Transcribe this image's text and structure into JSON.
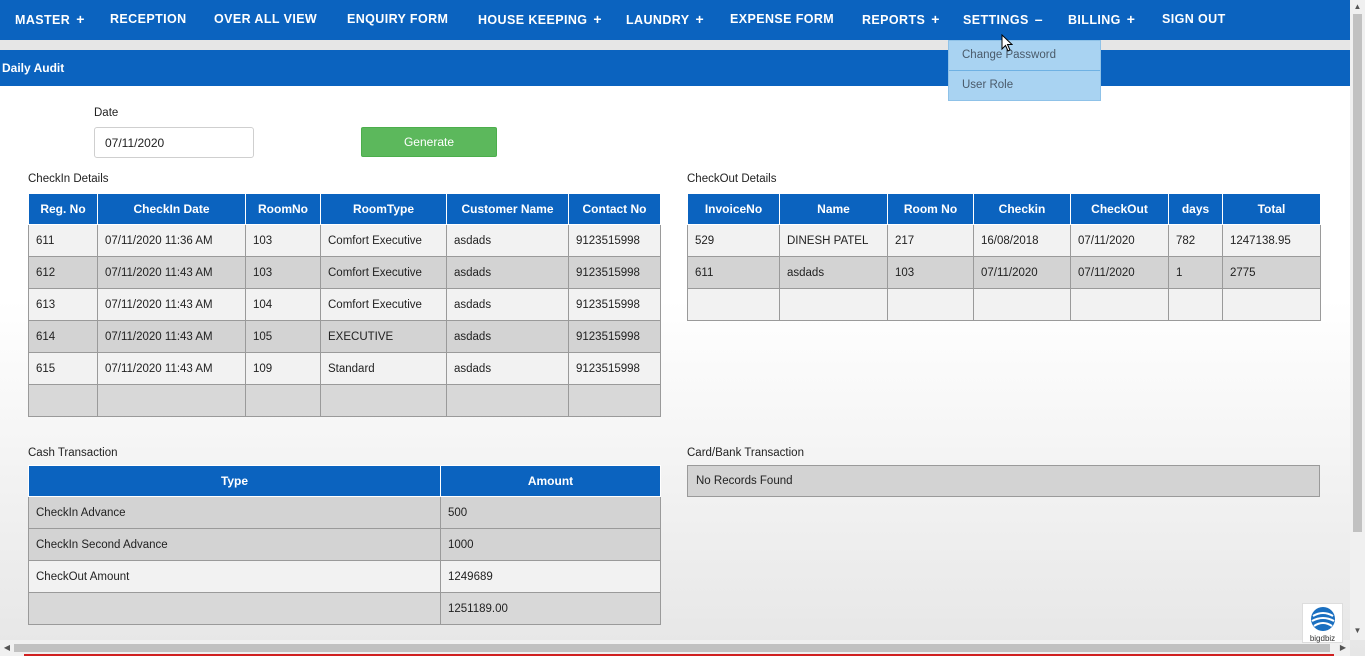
{
  "nav": {
    "items": [
      {
        "label": "MASTER",
        "sign": "+"
      },
      {
        "label": "RECEPTION",
        "sign": ""
      },
      {
        "label": "OVER ALL VIEW",
        "sign": ""
      },
      {
        "label": "ENQUIRY FORM",
        "sign": ""
      },
      {
        "label": "HOUSE KEEPING",
        "sign": "+"
      },
      {
        "label": "LAUNDRY",
        "sign": "+"
      },
      {
        "label": "EXPENSE FORM",
        "sign": ""
      },
      {
        "label": "REPORTS",
        "sign": "+"
      },
      {
        "label": "SETTINGS",
        "sign": "–"
      },
      {
        "label": "BILLING",
        "sign": "+"
      },
      {
        "label": "SIGN OUT",
        "sign": ""
      }
    ],
    "settings_menu": [
      "Change Password",
      "User Role"
    ]
  },
  "page_title": "Daily Audit",
  "form": {
    "date_label": "Date",
    "date_value": "07/11/2020",
    "generate_label": "Generate"
  },
  "checkin": {
    "title": "CheckIn Details",
    "headers": [
      "Reg. No",
      "CheckIn Date",
      "RoomNo",
      "RoomType",
      "Customer Name",
      "Contact No"
    ],
    "rows": [
      [
        "611",
        "07/11/2020 11:36 AM",
        "103",
        "Comfort Executive",
        "asdads",
        "9123515998"
      ],
      [
        "612",
        "07/11/2020 11:43 AM",
        "103",
        "Comfort Executive",
        "asdads",
        "9123515998"
      ],
      [
        "613",
        "07/11/2020 11:43 AM",
        "104",
        "Comfort Executive",
        "asdads",
        "9123515998"
      ],
      [
        "614",
        "07/11/2020 11:43 AM",
        "105",
        "EXECUTIVE",
        "asdads",
        "9123515998"
      ],
      [
        "615",
        "07/11/2020 11:43 AM",
        "109",
        "Standard",
        "asdads",
        "9123515998"
      ]
    ]
  },
  "checkout": {
    "title": "CheckOut Details",
    "headers": [
      "InvoiceNo",
      "Name",
      "Room No",
      "Checkin",
      "CheckOut",
      "days",
      "Total"
    ],
    "rows": [
      [
        "529",
        "DINESH PATEL",
        "217",
        "16/08/2018",
        "07/11/2020",
        "782",
        "1247138.95"
      ],
      [
        "611",
        "asdads",
        "103",
        "07/11/2020",
        "07/11/2020",
        "1",
        "2775"
      ]
    ]
  },
  "cash": {
    "title": "Cash Transaction",
    "headers": [
      "Type",
      "Amount"
    ],
    "rows": [
      [
        "CheckIn Advance",
        "500"
      ],
      [
        "CheckIn Second Advance",
        "1000"
      ],
      [
        "CheckOut Amount",
        "1249689"
      ]
    ],
    "total": "1251189.00"
  },
  "card": {
    "title": "Card/Bank Transaction",
    "empty_text": "No Records Found"
  },
  "logo_text": "bigdbiz"
}
